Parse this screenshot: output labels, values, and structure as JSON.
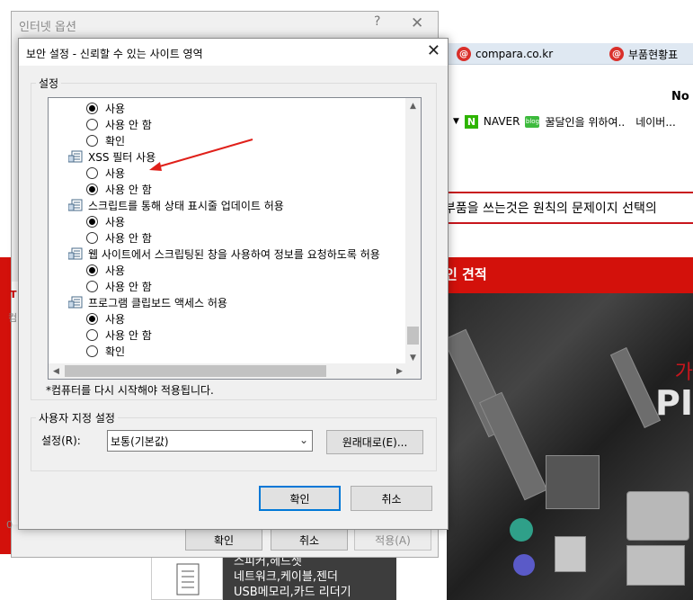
{
  "browser": {
    "tabs": [
      {
        "icon": "compara-icon",
        "label": "compara.co.kr"
      },
      {
        "icon": "compara-icon",
        "label": "부품현황표"
      }
    ],
    "user_label": "No",
    "favorites": {
      "naver": "NAVER",
      "blog_badge": "blog",
      "blog": "꿀달인을 위하여..",
      "naver_more": "네이버..."
    },
    "notice": "부품을 쓰는것은 원칙의 문제이지 선택의",
    "banner_label": "인 견적",
    "hero_hint": "가",
    "hero_big": "PI",
    "side_list": [
      "스피커,헤드셋",
      "네트워크,케이블,젠더",
      "USB메모리,카드 리더기"
    ],
    "left_stub_label_1": "T",
    "left_stub_label_2": "컴",
    "left_stub_label_3": "0"
  },
  "internet_options": {
    "title": "인터넷 옵션",
    "help": "?",
    "ok": "확인",
    "cancel": "취소",
    "apply": "적용(A)"
  },
  "security_dialog": {
    "title": "보안 설정 - 신뢰할 수 있는 사이트 영역",
    "settings_group": "설정",
    "tree_rows": [
      {
        "kind": "radio",
        "label": "사용",
        "checked": true
      },
      {
        "kind": "radio",
        "label": "사용 안 함",
        "checked": false
      },
      {
        "kind": "radio",
        "label": "확인",
        "checked": false
      },
      {
        "kind": "item",
        "label": "XSS 필터 사용"
      },
      {
        "kind": "radio",
        "label": "사용",
        "checked": false
      },
      {
        "kind": "radio",
        "label": "사용 안 함",
        "checked": true
      },
      {
        "kind": "item",
        "label": "스크립트를 통해 상태 표시줄 업데이트 허용"
      },
      {
        "kind": "radio",
        "label": "사용",
        "checked": true
      },
      {
        "kind": "radio",
        "label": "사용 안 함",
        "checked": false
      },
      {
        "kind": "item",
        "label": "웹 사이트에서 스크립팅된 창을 사용하여 정보를 요청하도록 허용"
      },
      {
        "kind": "radio",
        "label": "사용",
        "checked": true
      },
      {
        "kind": "radio",
        "label": "사용 안 함",
        "checked": false
      },
      {
        "kind": "item",
        "label": "프로그램 클립보드 액세스 허용"
      },
      {
        "kind": "radio",
        "label": "사용",
        "checked": true
      },
      {
        "kind": "radio",
        "label": "사용 안 함",
        "checked": false
      },
      {
        "kind": "radio",
        "label": "확인",
        "checked": false
      }
    ],
    "restart_note": "*컴퓨터를 다시 시작해야 적용됩니다.",
    "custom_group": "사용자 지정 설정",
    "reset_label": "설정(R):",
    "reset_value": "보통(기본값)",
    "reset_button": "원래대로(E)...",
    "ok": "확인",
    "cancel": "취소",
    "annotation_color": "#e0201a"
  }
}
